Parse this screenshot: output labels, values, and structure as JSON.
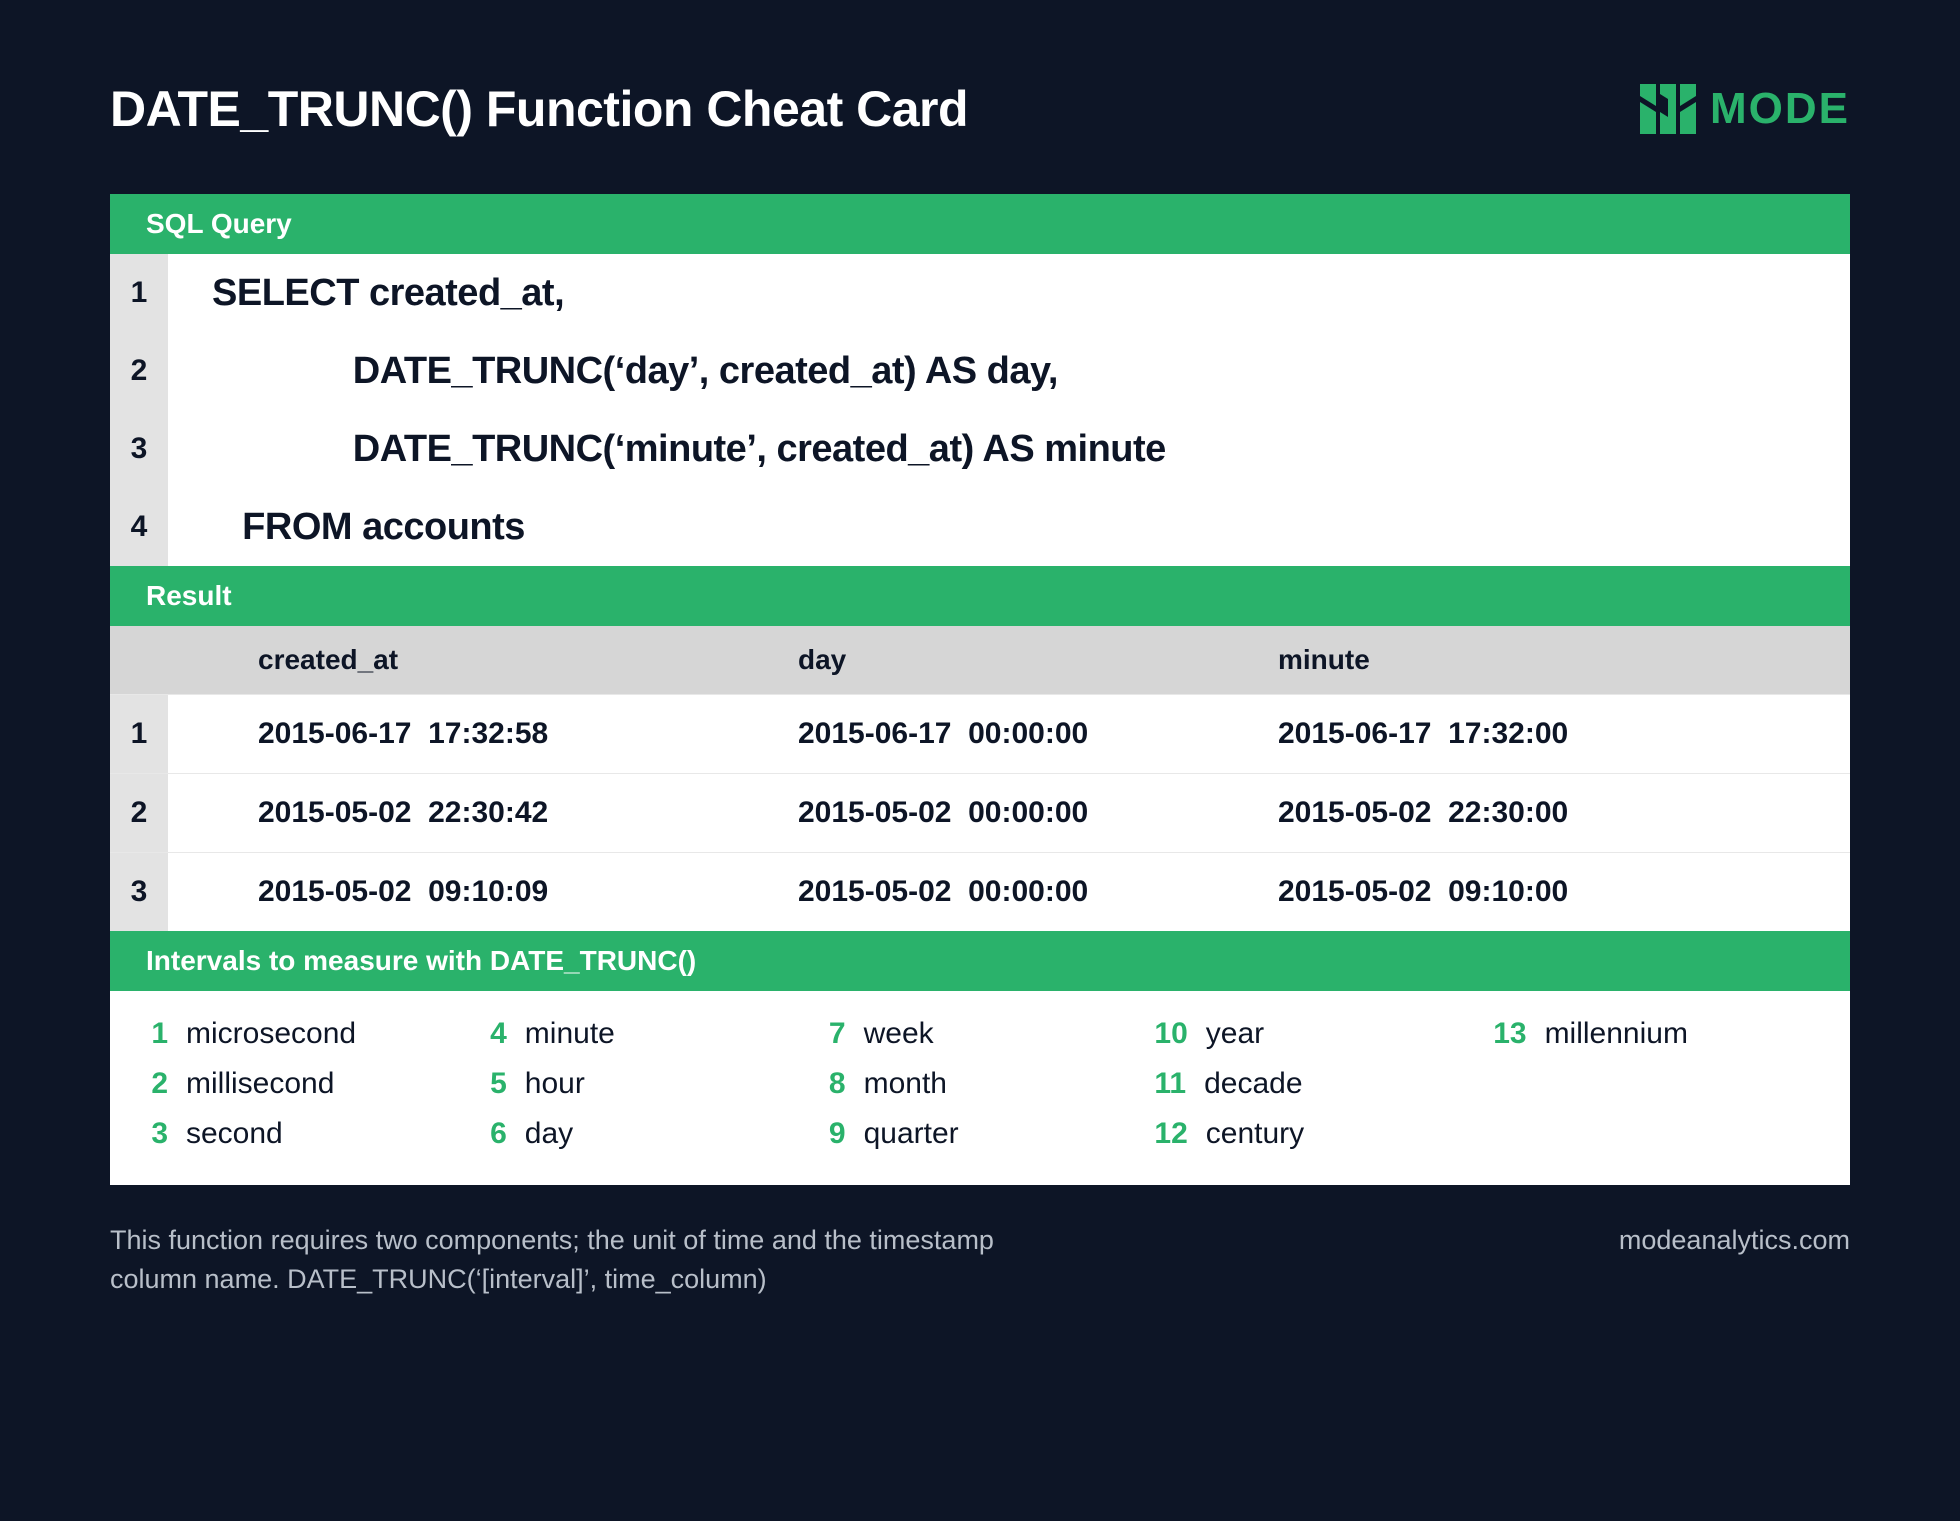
{
  "header": {
    "title": "DATE_TRUNC() Function Cheat Card",
    "brand": "MODE"
  },
  "query": {
    "section_label": "SQL Query",
    "lines": [
      "SELECT created_at,",
      "              DATE_TRUNC(‘day’, created_at) AS day,",
      "              DATE_TRUNC(‘minute’, created_at) AS minute",
      "   FROM accounts"
    ]
  },
  "result": {
    "section_label": "Result",
    "columns": [
      "created_at",
      "day",
      "minute"
    ],
    "rows": [
      [
        "2015-06-17  17:32:58",
        "2015-06-17  00:00:00",
        "2015-06-17  17:32:00"
      ],
      [
        "2015-05-02  22:30:42",
        "2015-05-02  00:00:00",
        "2015-05-02  22:30:00"
      ],
      [
        "2015-05-02  09:10:09",
        "2015-05-02  00:00:00",
        "2015-05-02  09:10:00"
      ]
    ]
  },
  "intervals": {
    "section_label": "Intervals to measure with DATE_TRUNC()",
    "items": [
      "microsecond",
      "millisecond",
      "second",
      "minute",
      "hour",
      "day",
      "week",
      "month",
      "quarter",
      "year",
      "decade",
      "century",
      "millennium"
    ]
  },
  "footer": {
    "note": "This function requires two components; the unit of time and the timestamp column name. DATE_TRUNC(‘[interval]’, time_column)",
    "site": "modeanalytics.com"
  }
}
